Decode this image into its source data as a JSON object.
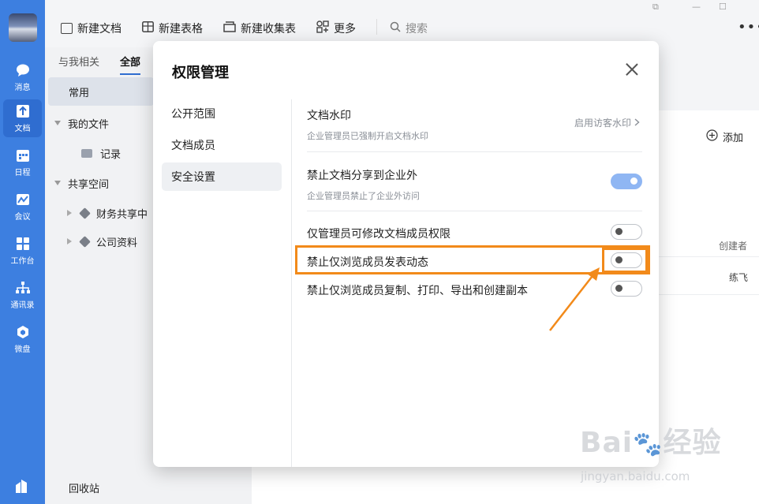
{
  "rail": {
    "items": [
      {
        "label": "消息",
        "icon": "chat-bubble-icon"
      },
      {
        "label": "文档",
        "icon": "document-icon"
      },
      {
        "label": "日程",
        "icon": "calendar-icon"
      },
      {
        "label": "会议",
        "icon": "meeting-icon"
      },
      {
        "label": "工作台",
        "icon": "grid-icon"
      },
      {
        "label": "通讯录",
        "icon": "org-chart-icon"
      },
      {
        "label": "微盘",
        "icon": "drive-icon"
      }
    ],
    "active_index": 1,
    "accent": "#3d7fe0"
  },
  "toolbar": {
    "new_doc": "新建文档",
    "new_sheet": "新建表格",
    "new_collect": "新建收集表",
    "more": "更多",
    "search_placeholder": "搜索"
  },
  "side": {
    "tab_related": "与我相关",
    "tab_all": "全部",
    "common": "常用",
    "my_files": "我的文件",
    "records": "记录",
    "shared_space": "共享空间",
    "finance": "财务共享中",
    "company": "公司资料",
    "recycle": "回收站"
  },
  "right": {
    "add": "添加",
    "creator_header": "创建者",
    "creator_value": "练飞"
  },
  "modal": {
    "title": "权限管理",
    "nav": [
      "公开范围",
      "文档成员",
      "安全设置"
    ],
    "nav_selected": 2,
    "watermark_title": "文档水印",
    "watermark_sub": "企业管理员已强制开启文档水印",
    "watermark_link": "启用访客水印",
    "share_title": "禁止文档分享到企业外",
    "share_sub": "企业管理员禁止了企业外访问",
    "share_on": true,
    "admin_only_title": "仅管理员可修改文档成员权限",
    "admin_only_on": false,
    "no_post_title": "禁止仅浏览成员发表动态",
    "no_post_on": false,
    "no_copy_title": "禁止仅浏览成员复制、打印、导出和创建副本",
    "no_copy_on": false
  },
  "annotation": {
    "color": "#f28a1a"
  },
  "watermark": {
    "brand": "Baidu经验",
    "url": "jingyan.baidu.com"
  }
}
